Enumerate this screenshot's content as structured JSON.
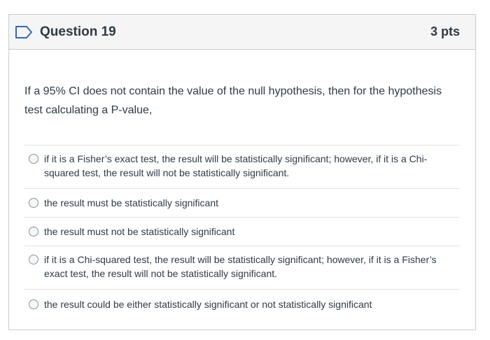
{
  "question": {
    "title": "Question 19",
    "points": "3 pts",
    "text": "If a 95% CI does not contain the value of the null hypothesis, then for the hypothesis test calculating a P-value,"
  },
  "answers": [
    {
      "label": "if it is a Fisher’s exact test, the result will be statistically significant; however, if it is a Chi-squared test, the result will not be statistically significant."
    },
    {
      "label": "the result must be statistically significant"
    },
    {
      "label": "the result must not be statistically significant"
    },
    {
      "label": "if it is a Chi-squared test, the result will be statistically significant; however, if it is a Fisher’s exact test, the result will not be statistically significant."
    },
    {
      "label": "the result could be either statistically significant or not statistically significant"
    }
  ],
  "colors": {
    "flag_icon": "#2d6bb3",
    "header_background": "#f5f5f5",
    "border": "#c7cdd1",
    "text": "#2d3b45"
  },
  "icons": {
    "flag": "bookmark-flag-icon",
    "radio": "radio-button-unselected"
  }
}
